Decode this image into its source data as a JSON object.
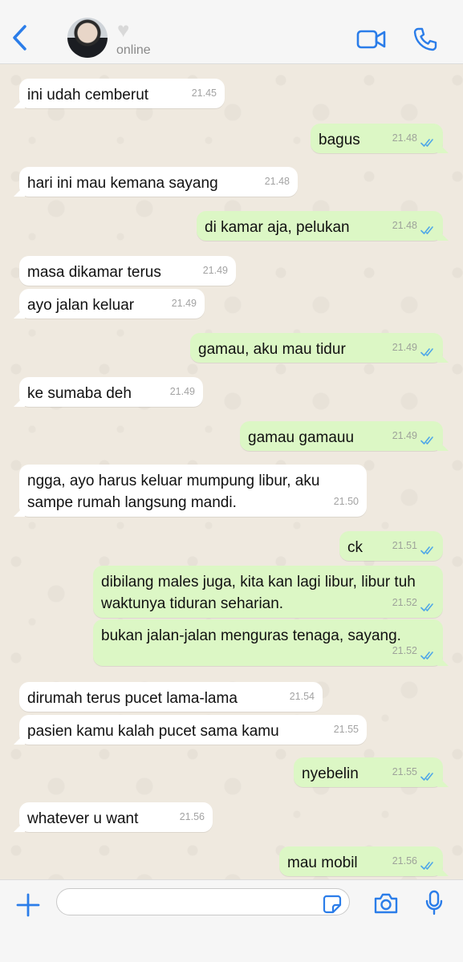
{
  "header": {
    "back_icon": "chevron-left-icon",
    "status": "online",
    "heart_icon": "heart-icon",
    "video_icon": "video-camera-icon",
    "call_icon": "phone-icon",
    "accent_color": "#2b7de9"
  },
  "messages": [
    {
      "dir": "in",
      "text": "ini udah cemberut",
      "time": "21.45"
    },
    {
      "dir": "out",
      "text": "bagus",
      "time": "21.48"
    },
    {
      "dir": "in",
      "text": "hari ini mau kemana sayang",
      "time": "21.48"
    },
    {
      "dir": "out",
      "text": "di kamar aja, pelukan",
      "time": "21.48"
    },
    {
      "dir": "in",
      "text": "masa dikamar terus",
      "time": "21.49"
    },
    {
      "dir": "in",
      "text": "ayo jalan keluar",
      "time": "21.49"
    },
    {
      "dir": "out",
      "text": "gamau, aku mau tidur",
      "time": "21.49"
    },
    {
      "dir": "in",
      "text": "ke sumaba deh",
      "time": "21.49"
    },
    {
      "dir": "out",
      "text": "gamau gamauu",
      "time": "21.49"
    },
    {
      "dir": "in",
      "text": "ngga, ayo harus keluar mumpung libur, aku sampe rumah langsung mandi.",
      "time": "21.50"
    },
    {
      "dir": "out",
      "text": "ck",
      "time": "21.51"
    },
    {
      "dir": "out",
      "text": "dibilang males juga, kita kan lagi libur, libur tuh waktunya tiduran seharian.",
      "time": "21.52"
    },
    {
      "dir": "out",
      "text": "bukan jalan-jalan menguras tenaga, sayang.",
      "time": "21.52"
    },
    {
      "dir": "in",
      "text": "dirumah terus pucet lama-lama",
      "time": "21.54"
    },
    {
      "dir": "in",
      "text": "pasien kamu kalah pucet sama kamu",
      "time": "21.55"
    },
    {
      "dir": "out",
      "text": "nyebelin",
      "time": "21.55"
    },
    {
      "dir": "in",
      "text": "whatever u want",
      "time": "21.56"
    },
    {
      "dir": "out",
      "text": "mau mobil",
      "time": "21.56"
    }
  ],
  "colors": {
    "incoming_bubble": "#ffffff",
    "outgoing_bubble": "#dcf7c5",
    "read_ticks": "#4fa7e8",
    "chat_background": "#efe9df"
  },
  "input_bar": {
    "plus_icon": "plus-icon",
    "sticker_icon": "sticker-icon",
    "camera_icon": "camera-icon",
    "mic_icon": "microphone-icon",
    "message_value": ""
  }
}
